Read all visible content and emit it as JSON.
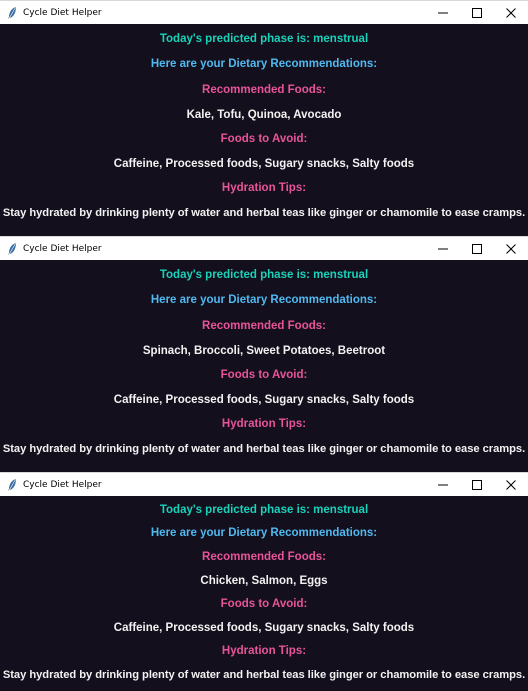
{
  "window_title": "Cycle Diet Helper",
  "phase_text": "Today's predicted phase is: menstrual",
  "intro_text": "Here are your Dietary Recommendations:",
  "recommended_heading": "Recommended Foods:",
  "avoid_heading": "Foods to Avoid:",
  "hydration_heading": "Hydration Tips:",
  "avoid_text": "Caffeine, Processed foods, Sugary snacks, Salty foods",
  "hydration_text": "Stay hydrated by drinking plenty of water and herbal teas like ginger or chamomile to ease cramps.",
  "windows": [
    {
      "recommended_foods": "Kale, Tofu, Quinoa, Avocado"
    },
    {
      "recommended_foods": "Spinach, Broccoli, Sweet Potatoes, Beetroot"
    },
    {
      "recommended_foods": "Chicken, Salmon, Eggs"
    }
  ],
  "icons": {
    "app": "feather-icon",
    "minimize": "minimize-icon",
    "maximize": "maximize-icon",
    "close": "close-icon"
  },
  "colors": {
    "background": "#130f1c",
    "phase": "#19d2ba",
    "intro": "#4fb9f0",
    "heading": "#e8549a",
    "body_text": "#f2f2f2"
  }
}
